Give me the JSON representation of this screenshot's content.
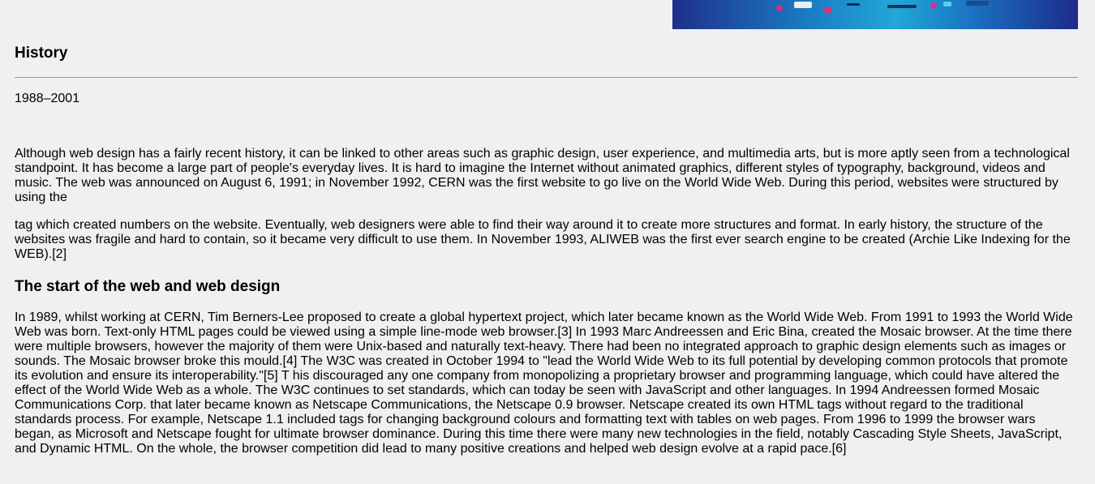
{
  "history": {
    "heading": "History",
    "years": "1988–2001",
    "paragraph1": "Although web design has a fairly recent history, it can be linked to other areas such as graphic design, user experience, and multimedia arts, but is more aptly seen from a technological standpoint. It has become a large part of people's everyday lives. It is hard to imagine the Internet without animated graphics, different styles of typography, background, videos and music. The web was announced on August 6, 1991; in November 1992, CERN was the first website to go live on the World Wide Web. During this period, websites were structured by using the",
    "paragraph2": "tag which created numbers on the website. Eventually, web designers were able to find their way around it to create more structures and format. In early history, the structure of the websites was fragile and hard to contain, so it became very difficult to use them. In November 1993, ALIWEB was the first ever search engine to be created (Archie Like Indexing for the WEB).[2]"
  },
  "start": {
    "heading": "The start of the web and web design",
    "paragraph": "In 1989, whilst working at CERN, Tim Berners-Lee proposed to create a global hypertext project, which later became known as the World Wide Web. From 1991 to 1993 the World Wide Web was born. Text-only HTML pages could be viewed using a simple line-mode web browser.[3] In 1993 Marc Andreessen and Eric Bina, created the Mosaic browser. At the time there were multiple browsers, however the majority of them were Unix-based and naturally text-heavy. There had been no integrated approach to graphic design elements such as images or sounds. The Mosaic browser broke this mould.[4] The W3C was created in October 1994 to \"lead the World Wide Web to its full potential by developing common protocols that promote its evolution and ensure its interoperability.\"[5] T his discouraged any one company from monopolizing a proprietary browser and programming language, which could have altered the effect of the World Wide Web as a whole. The W3C continues to set standards, which can today be seen with JavaScript and other languages. In 1994 Andreessen formed Mosaic Communications Corp. that later became known as Netscape Communications, the Netscape 0.9 browser. Netscape created its own HTML tags without regard to the traditional standards process. For example, Netscape 1.1 included tags for changing background colours and formatting text with tables on web pages. From 1996 to 1999 the browser wars began, as Microsoft and Netscape fought for ultimate browser dominance. During this time there were many new technologies in the field, notably Cascading Style Sheets, JavaScript, and Dynamic HTML. On the whole, the browser competition did lead to many positive creations and helped web design evolve at a rapid pace.[6]"
  },
  "colors": {
    "background": "#f0f0f0",
    "text": "#000000",
    "rule": "#9a9a9a",
    "banner_dark": "#1f2f8c",
    "banner_light": "#21a8d8"
  }
}
